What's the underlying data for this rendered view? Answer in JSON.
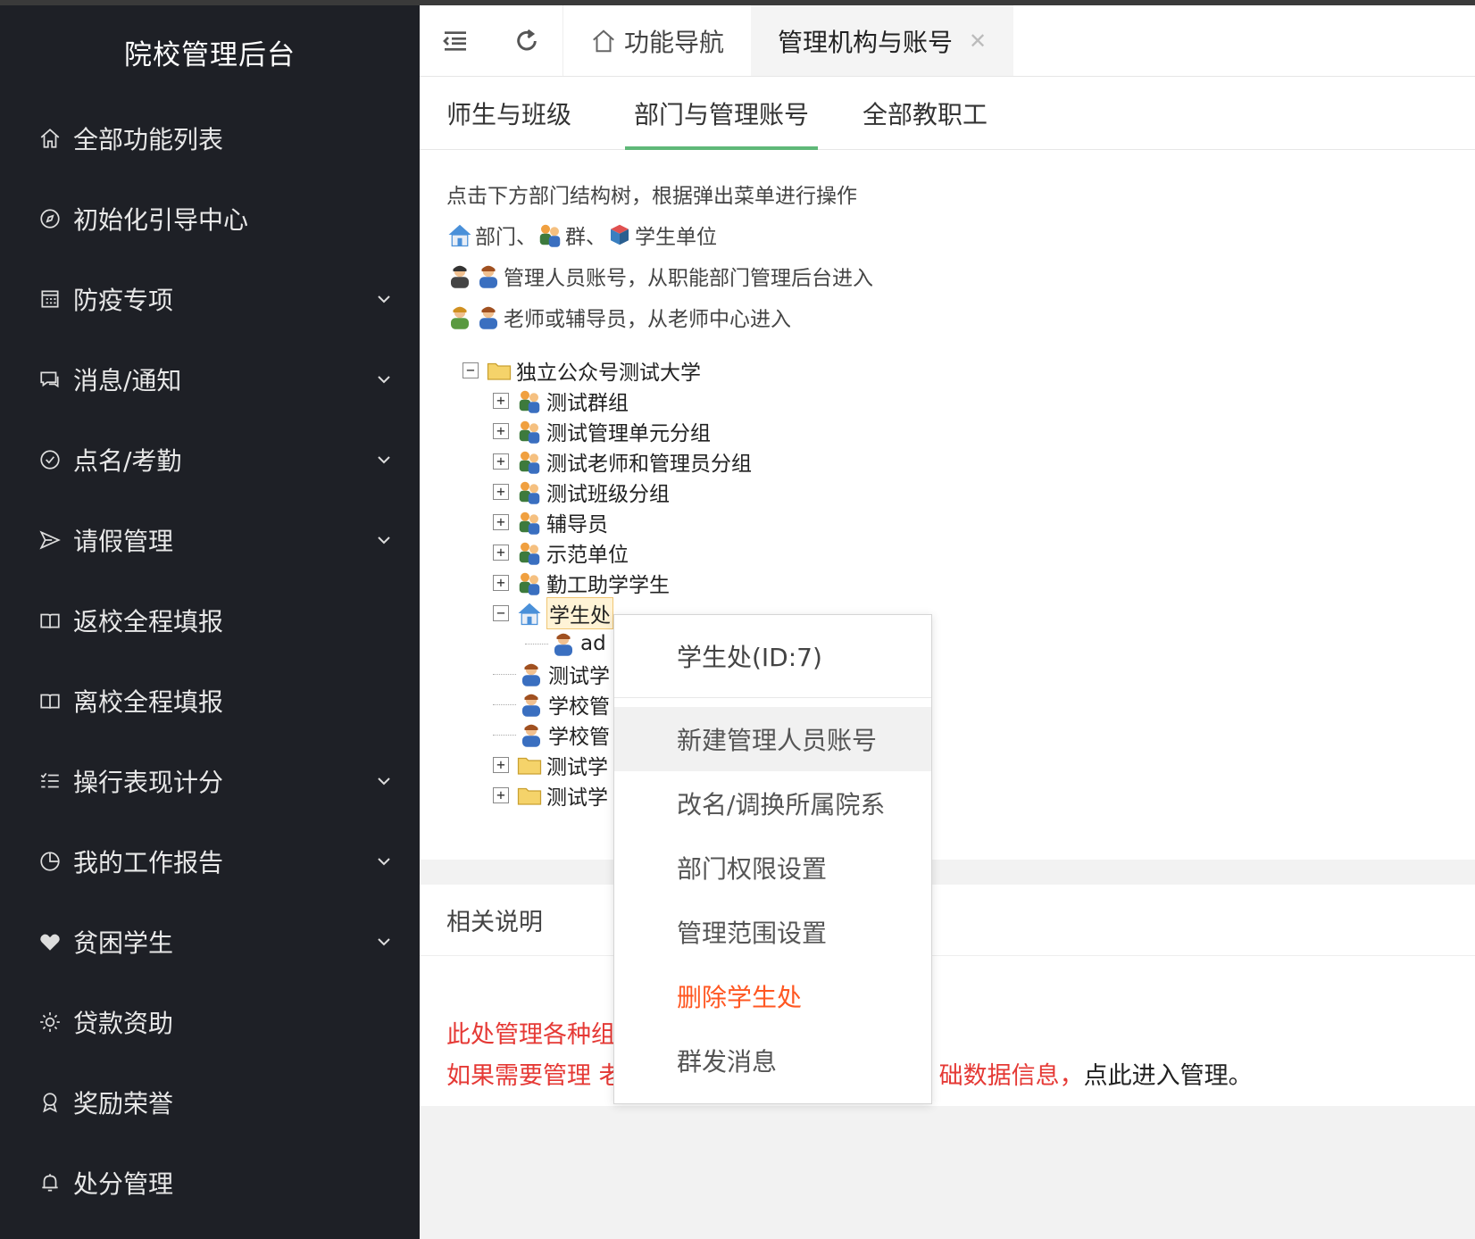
{
  "sidebar": {
    "brand": "院校管理后台",
    "items": [
      {
        "label": "全部功能列表",
        "icon": "home-icon",
        "has_sub": false
      },
      {
        "label": "初始化引导中心",
        "icon": "compass-icon",
        "has_sub": false
      },
      {
        "label": "防疫专项",
        "icon": "calendar-icon",
        "has_sub": true
      },
      {
        "label": "消息/通知",
        "icon": "chat-icon",
        "has_sub": true
      },
      {
        "label": "点名/考勤",
        "icon": "check-circle-icon",
        "has_sub": true
      },
      {
        "label": "请假管理",
        "icon": "send-icon",
        "has_sub": true
      },
      {
        "label": "返校全程填报",
        "icon": "book-icon",
        "has_sub": false
      },
      {
        "label": "离校全程填报",
        "icon": "book-icon",
        "has_sub": false
      },
      {
        "label": "操行表现计分",
        "icon": "list-icon",
        "has_sub": true
      },
      {
        "label": "我的工作报告",
        "icon": "clock-icon",
        "has_sub": true
      },
      {
        "label": "贫困学生",
        "icon": "heart-icon",
        "has_sub": true
      },
      {
        "label": "贷款资助",
        "icon": "sun-icon",
        "has_sub": false
      },
      {
        "label": "奖励荣誉",
        "icon": "award-icon",
        "has_sub": false
      },
      {
        "label": "处分管理",
        "icon": "bell-icon",
        "has_sub": false
      }
    ]
  },
  "topbar": {
    "tabs": [
      {
        "label": "功能导航",
        "icon": "home-icon"
      },
      {
        "label": "管理机构与账号",
        "closable": true
      }
    ]
  },
  "subtabs": [
    "师生与班级",
    "部门与管理账号",
    "全部教职工"
  ],
  "tree_section": {
    "hint": "点击下方部门结构树，根据弹出菜单进行操作",
    "legend": [
      {
        "text": "部门、"
      },
      {
        "text": "群、"
      },
      {
        "text": "学生单位"
      }
    ],
    "legend2": "管理人员账号，从职能部门管理后台进入",
    "legend3": "老师或辅导员，从老师中心进入"
  },
  "tree": {
    "root": "独立公众号测试大学",
    "groups": [
      "测试群组",
      "测试管理单元分组",
      "测试老师和管理员分组",
      "测试班级分组",
      "辅导员",
      "示范单位",
      "勤工助学学生"
    ],
    "selected": "学生处",
    "selected_child": "ad",
    "users": [
      "测试学",
      "学校管",
      "学校管"
    ],
    "folders": [
      "测试学",
      "测试学"
    ]
  },
  "notes": {
    "title": "相关说明",
    "line1": "此处管理各种组",
    "line2_a": "如果需要管理 老",
    "line2_b": "础数据信息，",
    "line2_c": "点此进入管理。"
  },
  "context_menu": {
    "title": "学生处(ID:7)",
    "items": [
      {
        "label": "新建管理人员账号",
        "highlight": true
      },
      {
        "label": "改名/调换所属院系"
      },
      {
        "label": "部门权限设置"
      },
      {
        "label": "管理范围设置"
      },
      {
        "label": "删除学生处",
        "danger": true
      },
      {
        "label": "群发消息"
      }
    ]
  },
  "colors": {
    "sidebar_bg": "#1e2026",
    "accent_green": "#5fb878",
    "danger": "#ff5722",
    "note_red": "#e53935"
  }
}
